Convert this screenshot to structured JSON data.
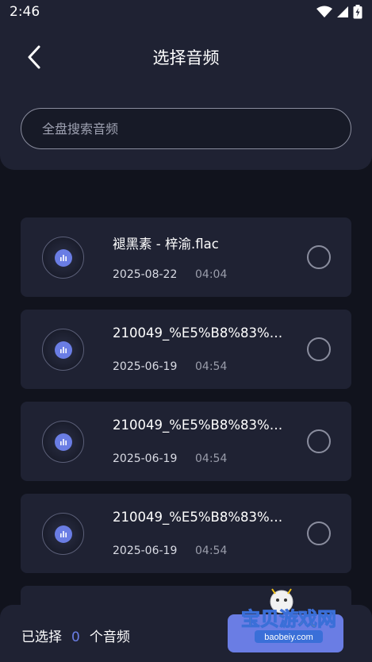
{
  "status_bar": {
    "time": "2:46"
  },
  "header": {
    "title": "选择音频"
  },
  "search": {
    "placeholder": "全盘搜索音频"
  },
  "files": [
    {
      "name": "褪黑素 - 梓渝.flac",
      "date": "2025-08-22",
      "duration": "04:04"
    },
    {
      "name": "210049_%E5%B8%83%E...",
      "date": "2025-06-19",
      "duration": "04:54"
    },
    {
      "name": "210049_%E5%B8%83%E...",
      "date": "2025-06-19",
      "duration": "04:54"
    },
    {
      "name": "210049_%E5%B8%83%E...",
      "date": "2025-06-19",
      "duration": "04:54"
    }
  ],
  "footer": {
    "selected_prefix": "已选择",
    "selected_count": "0",
    "selected_suffix": "个音频"
  },
  "watermark": {
    "title": "宝贝游戏网",
    "url": "baobeiy.com"
  },
  "colors": {
    "accent": "#6a7de4",
    "background": "#11131d",
    "card": "#1f2233"
  }
}
